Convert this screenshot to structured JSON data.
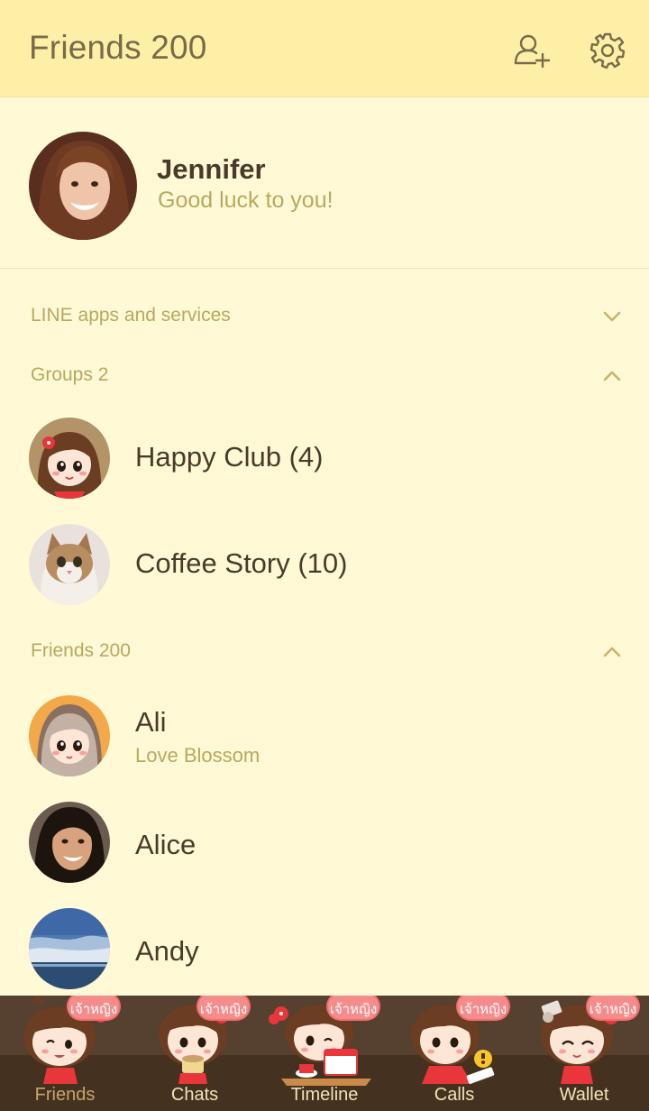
{
  "header": {
    "title": "Friends 200"
  },
  "profile": {
    "name": "Jennifer",
    "status": "Good luck to you!"
  },
  "sections": {
    "apps": "LINE apps and services",
    "groups": "Groups 2",
    "friends": "Friends 200"
  },
  "groups": [
    {
      "name": "Happy Club (4)",
      "avatar": "cartoon-girl-avatar"
    },
    {
      "name": "Coffee Story (10)",
      "avatar": "cat-photo-avatar"
    }
  ],
  "friends": [
    {
      "name": "Ali",
      "status": "Love Blossom",
      "avatar": "cartoon-girl-avatar"
    },
    {
      "name": "Alice",
      "status": "",
      "avatar": "woman-photo-avatar"
    },
    {
      "name": "Andy",
      "status": "",
      "avatar": "sky-photo-avatar"
    }
  ],
  "tabs": [
    {
      "label": "Friends",
      "active": true
    },
    {
      "label": "Chats",
      "active": false
    },
    {
      "label": "Timeline",
      "active": false
    },
    {
      "label": "Calls",
      "active": false
    },
    {
      "label": "Wallet",
      "active": false
    }
  ],
  "badge_text": "เจ้าหญิง",
  "colors": {
    "header_bg": "#fdf0a6",
    "page_bg": "#fff9d6",
    "accent_text": "#b8a860",
    "tabbar_bg": "#45311f"
  }
}
